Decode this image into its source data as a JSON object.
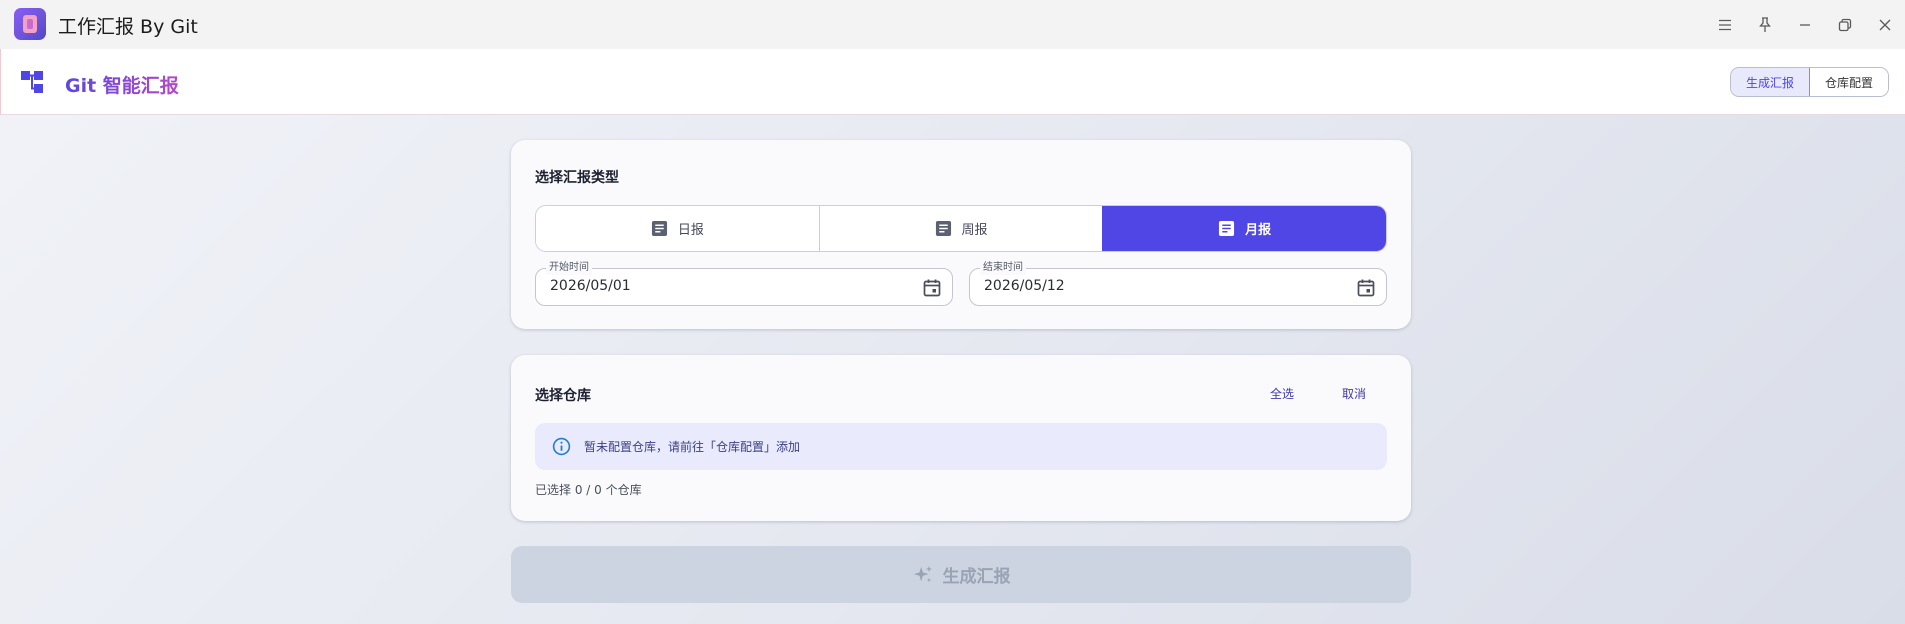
{
  "window": {
    "title": "工作汇报 By Git",
    "controls": [
      "menu-icon",
      "pin-icon",
      "minimize-icon",
      "restore-icon",
      "close-icon"
    ]
  },
  "header": {
    "brand": "Git 智能汇报",
    "tabs": [
      {
        "label": "生成汇报",
        "active": true
      },
      {
        "label": "仓库配置",
        "active": false
      }
    ]
  },
  "report_type": {
    "title": "选择汇报类型",
    "options": [
      {
        "label": "日报",
        "icon": "document-icon",
        "active": false
      },
      {
        "label": "周报",
        "icon": "document-icon",
        "active": false
      },
      {
        "label": "月报",
        "icon": "document-icon",
        "active": true
      }
    ],
    "start": {
      "label": "开始时间",
      "value": "2026/05/01"
    },
    "end": {
      "label": "结束时间",
      "value": "2026/05/12"
    }
  },
  "repo": {
    "title": "选择仓库",
    "select_all": "全选",
    "cancel": "取消",
    "notice": "暂未配置仓库，请前往「仓库配置」添加",
    "count": "已选择 0 / 0 个仓库"
  },
  "generate": {
    "label": "生成汇报",
    "disabled": true
  },
  "colors": {
    "accent": "#4f46e5",
    "brand_gradient_end": "#b548c6"
  }
}
